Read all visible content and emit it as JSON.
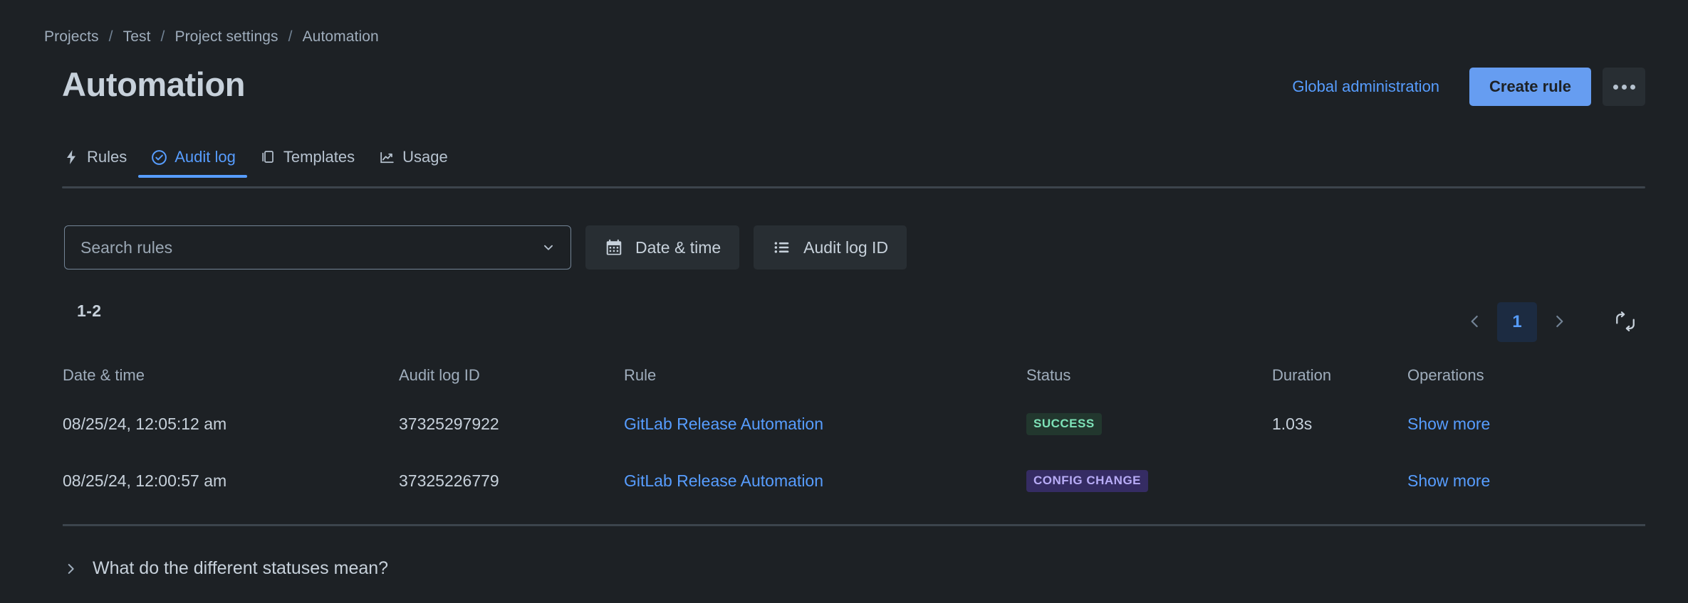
{
  "breadcrumb": {
    "separator": "/",
    "items": [
      {
        "label": "Projects"
      },
      {
        "label": "Test"
      },
      {
        "label": "Project settings"
      },
      {
        "label": "Automation"
      }
    ]
  },
  "header": {
    "title": "Automation",
    "global_admin_label": "Global administration",
    "create_rule_label": "Create rule",
    "more_actions_label": "•••"
  },
  "tabs": [
    {
      "label": "Rules",
      "icon": "lightning-icon",
      "active": false
    },
    {
      "label": "Audit log",
      "icon": "check-circle-icon",
      "active": true
    },
    {
      "label": "Templates",
      "icon": "copy-icon",
      "active": false
    },
    {
      "label": "Usage",
      "icon": "chart-line-icon",
      "active": false
    }
  ],
  "filters": {
    "search_placeholder": "Search rules",
    "search_value": "",
    "date_time_label": "Date & time",
    "audit_log_id_label": "Audit log ID"
  },
  "pagination": {
    "range": "1-2",
    "current_page": "1",
    "prev_label": "‹",
    "next_label": "›"
  },
  "table": {
    "columns": [
      "Date & time",
      "Audit log ID",
      "Rule",
      "Status",
      "Duration",
      "Operations"
    ],
    "rows": [
      {
        "date": "08/25/24, 12:05:12 am",
        "audit_log_id": "37325297922",
        "rule": "GitLab Release Automation",
        "status": "SUCCESS",
        "status_kind": "success",
        "duration": "1.03s",
        "operation": "Show more"
      },
      {
        "date": "08/25/24, 12:00:57 am",
        "audit_log_id": "37325226779",
        "rule": "GitLab Release Automation",
        "status": "CONFIG CHANGE",
        "status_kind": "config",
        "duration": "",
        "operation": "Show more"
      }
    ]
  },
  "footer": {
    "accordion_label": "What do the different statuses mean?"
  },
  "colors": {
    "background": "#1d2125",
    "accent_blue": "#579dff",
    "primary_button": "#669df1",
    "text_primary": "#c7d1db",
    "text_secondary": "#9fadbc",
    "badge_success_bg": "#22372e",
    "badge_success_text": "#7ee2b8",
    "badge_config_bg": "#352c63",
    "badge_config_text": "#b8acf6"
  }
}
